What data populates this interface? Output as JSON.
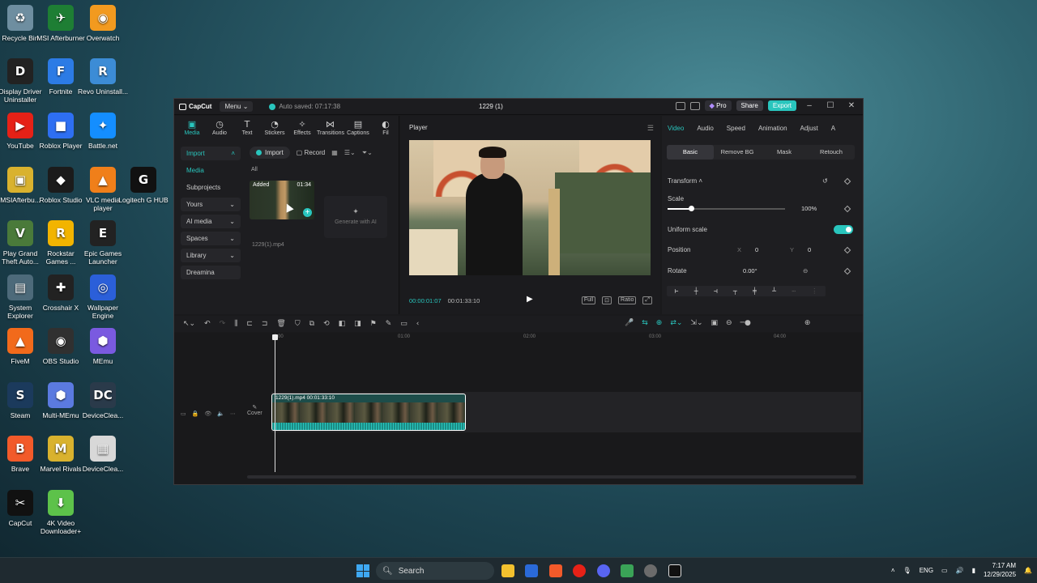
{
  "desktop": {
    "icons": [
      {
        "label": "Recycle Bin",
        "color": "#6e8ea0",
        "glyph": "♻"
      },
      {
        "label": "MSI Afterburner",
        "color": "#1e7e34",
        "glyph": "✈"
      },
      {
        "label": "Overwatch",
        "color": "#f29a1f",
        "glyph": "◉"
      },
      {
        "label": "Display Driver Uninstaller",
        "color": "#222222",
        "glyph": "D"
      },
      {
        "label": "Fortnite",
        "color": "#2c7be5",
        "glyph": "F"
      },
      {
        "label": "Revo Uninstall...",
        "color": "#3c8cd6",
        "glyph": "R"
      },
      {
        "label": "YouTube",
        "color": "#e62117",
        "glyph": "▶"
      },
      {
        "label": "Roblox Player",
        "color": "#2e6ff2",
        "glyph": "■"
      },
      {
        "label": "Battle.net",
        "color": "#148eff",
        "glyph": "✦"
      },
      {
        "label": "MSIAfterbu...",
        "color": "#d9b22e",
        "glyph": "▣"
      },
      {
        "label": "Roblox Studio",
        "color": "#1b1b1b",
        "glyph": "◆"
      },
      {
        "label": "VLC media player",
        "color": "#f07f1a",
        "glyph": "▲"
      },
      {
        "label": "Logitech G HUB",
        "color": "#111111",
        "glyph": "G"
      },
      {
        "label": "Play Grand Theft Auto...",
        "color": "#4a7a3a",
        "glyph": "V"
      },
      {
        "label": "Rockstar Games ...",
        "color": "#f2b400",
        "glyph": "R"
      },
      {
        "label": "Epic Games Launcher",
        "color": "#222222",
        "glyph": "E"
      },
      {
        "label": "System Explorer",
        "color": "#4d6a7a",
        "glyph": "▤"
      },
      {
        "label": "Crosshair X",
        "color": "#222222",
        "glyph": "✚"
      },
      {
        "label": "Wallpaper Engine",
        "color": "#2b5fd9",
        "glyph": "◎"
      },
      {
        "label": "FiveM",
        "color": "#f26a1b",
        "glyph": "▲"
      },
      {
        "label": "OBS Studio",
        "color": "#303030",
        "glyph": "◉"
      },
      {
        "label": "MEmu",
        "color": "#7a5ae0",
        "glyph": "⬢"
      },
      {
        "label": "Steam",
        "color": "#1b3a5c",
        "glyph": "S"
      },
      {
        "label": "Multi-MEmu",
        "color": "#5b7ae0",
        "glyph": "⬢"
      },
      {
        "label": "DeviceClea...",
        "color": "#2a3a4a",
        "glyph": "DC"
      },
      {
        "label": "Brave",
        "color": "#f25a2a",
        "glyph": "B"
      },
      {
        "label": "Marvel Rivals",
        "color": "#d9b22e",
        "glyph": "M"
      },
      {
        "label": "DeviceClea...",
        "color": "#d8d8d8",
        "glyph": "▦"
      },
      {
        "label": "CapCut",
        "color": "#111111",
        "glyph": "✂"
      },
      {
        "label": "4K Video Downloader+",
        "color": "#5dc24a",
        "glyph": "⬇"
      }
    ]
  },
  "capcut": {
    "logo": "CapCut",
    "menu": "Menu",
    "autosave": "Auto saved: 07:17:38",
    "project_title": "1229 (1)",
    "pro": "Pro",
    "share": "Share",
    "export": "Export",
    "tool_tabs": [
      {
        "label": "Media",
        "icon": "▣"
      },
      {
        "label": "Audio",
        "icon": "◷"
      },
      {
        "label": "Text",
        "icon": "T"
      },
      {
        "label": "Stickers",
        "icon": "◔"
      },
      {
        "label": "Effects",
        "icon": "✧"
      },
      {
        "label": "Transitions",
        "icon": "⋈"
      },
      {
        "label": "Captions",
        "icon": "▤"
      },
      {
        "label": "Fil",
        "icon": "◐"
      }
    ],
    "sidebar": [
      {
        "label": "Import",
        "arrow": "˄"
      },
      {
        "label": "Media",
        "arrow": ""
      },
      {
        "label": "Subprojects",
        "arrow": ""
      },
      {
        "label": "Yours",
        "arrow": "⌄"
      },
      {
        "label": "AI media",
        "arrow": "⌄"
      },
      {
        "label": "Spaces",
        "arrow": "⌄"
      },
      {
        "label": "Library",
        "arrow": "⌄"
      },
      {
        "label": "Dreamina",
        "arrow": ""
      }
    ],
    "media": {
      "import_label": "Import",
      "record_label": "Record",
      "all_label": "All",
      "thumb_badge": "Added",
      "thumb_duration": "01:34",
      "thumb_name": "1229(1).mp4",
      "generate_ai": "Generate with AI"
    },
    "player": {
      "title": "Player",
      "current_time": "00:00:01:07",
      "total_time": "00:01:33:10",
      "full_label": "Full",
      "ratio_label": "Ratio"
    },
    "props": {
      "tabs": [
        "Video",
        "Audio",
        "Speed",
        "Animation",
        "Adjust",
        "A"
      ],
      "sub_tabs": [
        "Basic",
        "Remove BG",
        "Mask",
        "Retouch"
      ],
      "transform": "Transform",
      "scale_label": "Scale",
      "scale_value": "100%",
      "scale_level": 0.2,
      "uniform_scale": "Uniform scale",
      "position_label": "Position",
      "x_label": "X",
      "x_value": "0",
      "y_label": "Y",
      "y_value": "0",
      "rotate_label": "Rotate",
      "rotate_value": "0.00°"
    },
    "timeline": {
      "ruler": [
        "0:00",
        "01:00",
        "02:00",
        "03:00",
        "04:00"
      ],
      "cover_label": "Cover",
      "clip_label": "1229(1).mp4   00:01:33:10"
    }
  },
  "taskbar": {
    "search": "Search",
    "lang": "ENG",
    "time": "7:17 AM",
    "date": "12/29/2025"
  }
}
